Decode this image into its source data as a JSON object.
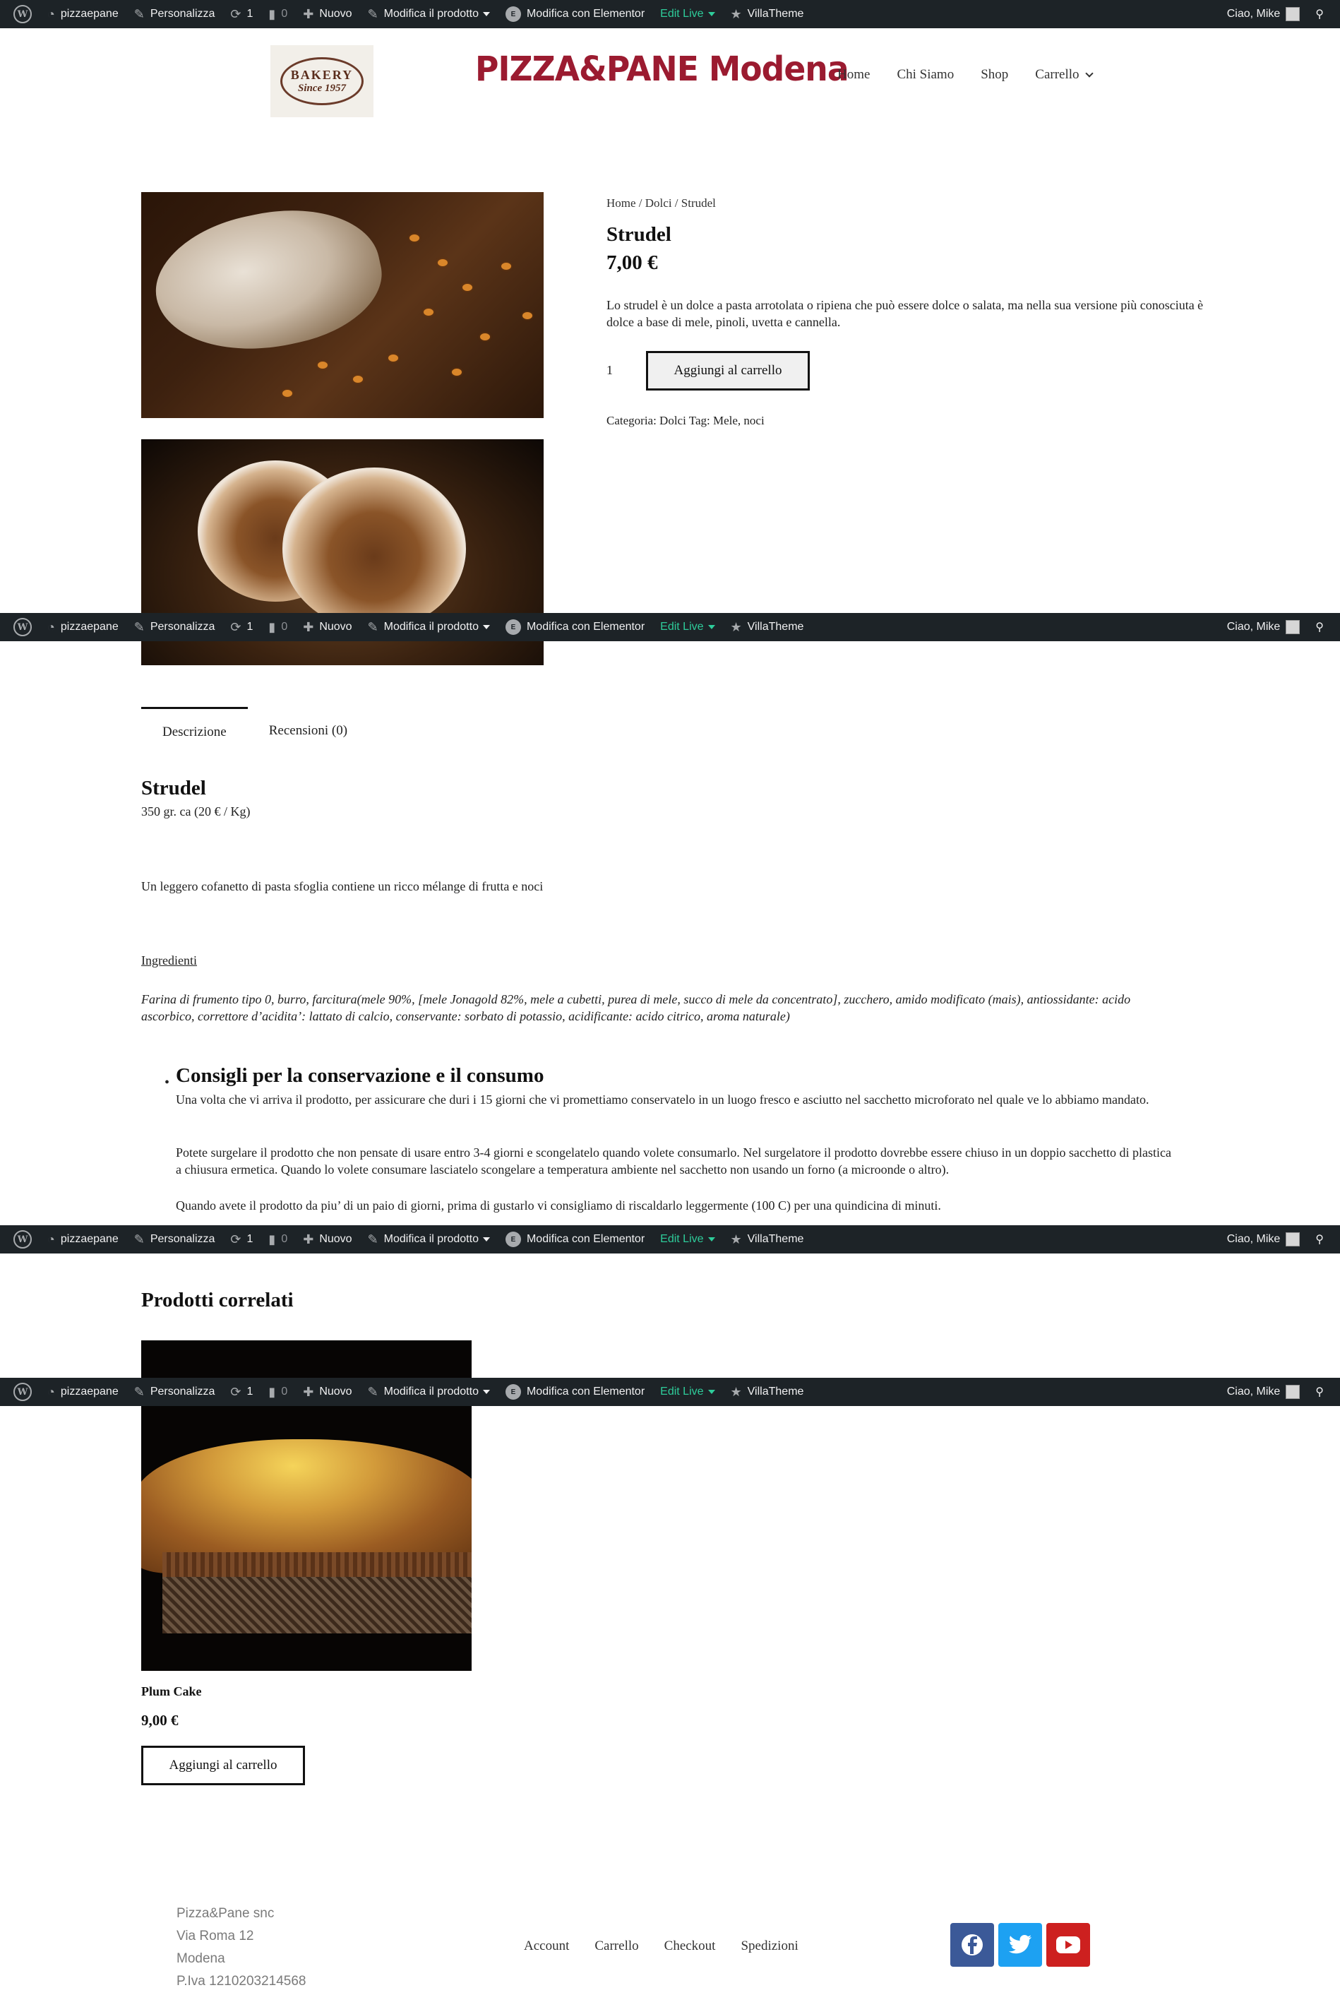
{
  "adminbar": {
    "site": "pizzaepane",
    "customize": "Personalizza",
    "updates": "1",
    "comments": "0",
    "new": "Nuovo",
    "edit_product": "Modifica il prodotto",
    "elementor": "Modifica con Elementor",
    "edit_live": "Edit Live",
    "villatheme": "VillaTheme",
    "greeting": "Ciao, Mike"
  },
  "header": {
    "logo_line1": "BAKERY",
    "logo_line2": "Since 1957",
    "site_title": "PIZZA&PANE Modena",
    "nav": [
      "Home",
      "Chi Siamo",
      "Shop",
      "Carrello"
    ]
  },
  "product": {
    "breadcrumb": "Home / Dolci / Strudel",
    "title": "Strudel",
    "price": "7,00 €",
    "short_description": "Lo strudel è un dolce a pasta arrotolata o ripiena che può essere dolce o salata, ma nella sua versione più conosciuta è dolce a base di mele, pinoli, uvetta e cannella.",
    "quantity": "1",
    "add_to_cart": "Aggiungi al carrello",
    "meta": "Categoria: Dolci  Tag: Mele, noci"
  },
  "tabs": [
    "Descrizione",
    "Recensioni (0)"
  ],
  "description": {
    "title": "Strudel",
    "weight": "350 gr. ca (20 € / Kg)",
    "intro": "Un leggero cofanetto di pasta sfoglia contiene un ricco mélange di frutta e noci",
    "ingredients_label": "Ingredienti",
    "ingredients": "Farina di frumento tipo 0, burro, farcitura(mele 90%, [mele Jonagold 82%, mele a cubetti, purea di mele, succo di mele da concentrato], zucchero, amido modificato (mais), antiossidante: acido ascorbico, correttore d’acidita’: lattato di calcio, conservante: sorbato di potassio, acidificante: acido citrico, aroma naturale)",
    "consigli_title": "Consigli per la conservazione e il consumo",
    "p1": "Una volta che vi arriva il prodotto, per assicurare che duri i 15 giorni che vi promettiamo conservatelo in un luogo fresco e asciutto nel sacchetto microforato nel quale ve lo abbiamo mandato.",
    "p2": "Potete surgelare il prodotto che non pensate di usare entro 3-4 giorni e scongelatelo quando volete consumarlo. Nel surgelatore il prodotto dovrebbe essere chiuso in un doppio sacchetto di plastica a chiusura ermetica. Quando lo volete consumare lasciatelo scongelare a temperatura ambiente nel sacchetto non usando un forno (a microonde o altro).",
    "p3": "Quando avete il prodotto da piu’ di un paio di giorni, prima di gustarlo vi consigliamo di riscaldarlo leggermente (100 C) per una quindicina di minuti."
  },
  "related": {
    "title": "Prodotti correlati",
    "name": "Plum Cake",
    "price": "9,00 €",
    "add_to_cart": "Aggiungi al carrello"
  },
  "footer": {
    "company": "Pizza&Pane snc",
    "street": "Via Roma 12",
    "city": "Modena",
    "vat": "P.Iva 1210203214568",
    "links": [
      "Account",
      "Carrello",
      "Checkout",
      "Spedizioni"
    ]
  },
  "colors": {
    "adminbar_bg": "#1d2327",
    "brand_red": "#9b1b30",
    "edit_live_green": "#2ecc9a",
    "facebook": "#3b5998",
    "twitter": "#1da1f2",
    "youtube": "#cd201f"
  },
  "icons": [
    "wordpress-icon",
    "dashboard-icon",
    "brush-icon",
    "updates-icon",
    "comment-icon",
    "plus-icon",
    "pencil-icon",
    "elementor-icon",
    "star-icon",
    "search-icon",
    "facebook-icon",
    "twitter-icon",
    "youtube-icon"
  ]
}
